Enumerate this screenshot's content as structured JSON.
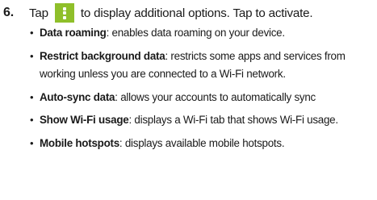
{
  "step": {
    "number": "6.",
    "text_before_icon": "Tap",
    "icon": "more-options-vertical-dots-icon",
    "icon_color": "#8fbf2a",
    "text_after_icon": "to display additional options. Tap to activate."
  },
  "options": [
    {
      "term": "Data roaming",
      "separator": ":",
      "description": " enables data roaming on your device."
    },
    {
      "term": "Restrict background data",
      "separator": ":",
      "description": " restricts some apps and services from working unless you are connected to a Wi-Fi network."
    },
    {
      "term": "Auto-sync data",
      "separator": ":",
      "description": " allows your accounts to automatically sync"
    },
    {
      "term": "Show Wi-Fi usage",
      "separator": ":",
      "description": " displays a Wi-Fi tab that shows Wi-Fi usage."
    },
    {
      "term": "Mobile hotspots",
      "separator": ":",
      "description": " displays available mobile hotspots."
    }
  ]
}
